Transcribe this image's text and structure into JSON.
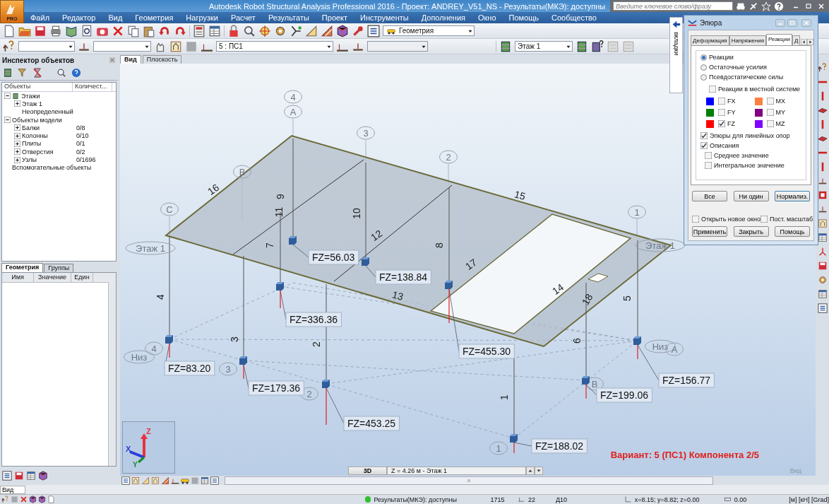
{
  "app": {
    "badge": "PRO"
  },
  "window": {
    "title": "Autodesk Robot Structural Analysis Professional 2016 - Проект: ANDREY_V51_NS - Результаты(МКЭ): доступны"
  },
  "search": {
    "placeholder": "Введите ключевое слово/фразу"
  },
  "menu": [
    "Файл",
    "Редактор",
    "Вид",
    "Геометрия",
    "Нагрузки",
    "Расчет",
    "Результаты",
    "Проект",
    "Инструменты",
    "Дополнения",
    "Окно",
    "Помощь",
    "Сообщество"
  ],
  "toolbar": {
    "view_combo": "Геометрия",
    "case_combo": "5 : ПС1",
    "floor_combo": "Этаж 1"
  },
  "inspector": {
    "title": "Инспектор объектов",
    "columns": [
      "Объекты",
      "Количест..."
    ],
    "tree": [
      {
        "label": "Этажи",
        "expanded": true,
        "children": [
          {
            "label": "Этаж 1",
            "expanded": false
          },
          {
            "label": "Неопределенный"
          }
        ]
      },
      {
        "label": "Объекты модели",
        "expanded": true,
        "children": [
          {
            "label": "Балки",
            "count": "0/8",
            "expanded": false
          },
          {
            "label": "Колонны",
            "count": "0/10",
            "expanded": false
          },
          {
            "label": "Плиты",
            "count": "0/1",
            "expanded": false
          },
          {
            "label": "Отверстия",
            "count": "0/2",
            "expanded": false
          },
          {
            "label": "Узлы",
            "count": "0/1696",
            "expanded": false
          }
        ]
      },
      {
        "label": "Вспомогательные объекты"
      }
    ],
    "tabs": [
      {
        "label": "Геометрия",
        "selected": true
      },
      {
        "label": "Группы",
        "selected": false
      }
    ],
    "props_columns": [
      "Имя",
      "Значение",
      "Един"
    ]
  },
  "view_tabs": [
    {
      "label": "Вид",
      "selected": true
    },
    {
      "label": "Плоскость",
      "selected": false
    }
  ],
  "viewport": {
    "member_labels": [
      "16",
      "11",
      "9",
      "10",
      "12",
      "7",
      "8",
      "17",
      "15",
      "13",
      "14",
      "18",
      "4",
      "3",
      "2",
      "1",
      "6",
      "5"
    ],
    "axis_labels": [
      "4",
      "A",
      "3",
      "2",
      "B",
      "C",
      "Этаж 1",
      "1",
      "Этаж 1",
      "Низ",
      "4",
      "3",
      "2",
      "1",
      "B",
      "Низ",
      "A"
    ],
    "reactions": [
      "FZ=56.03",
      "FZ=138.84",
      "FZ=336.36",
      "FZ=455.30",
      "FZ=83.20",
      "FZ=179.36",
      "FZ=453.25",
      "FZ=188.02",
      "FZ=199.06",
      "FZ=156.77"
    ],
    "triad": [
      "Z",
      "X",
      "Y"
    ],
    "caption": "Вариант: 5 (ПС1) Компонента 2/5",
    "mode_button": "3D",
    "level_field": "Z = 4.26 м - Этаж 1",
    "view_label": "Вид"
  },
  "dialog": {
    "title": "Эпюра",
    "side_tab": "вкладки",
    "tabs": [
      {
        "label": "Деформация",
        "selected": false
      },
      {
        "label": "Напряжения",
        "selected": false
      },
      {
        "label": "Реакции",
        "selected": true
      },
      {
        "label": "Д",
        "selected": false
      }
    ],
    "radios": [
      {
        "label": "Реакции",
        "selected": true
      },
      {
        "label": "Остаточные усилия",
        "selected": false
      },
      {
        "label": "Псевдостатические силы",
        "selected": false
      }
    ],
    "local_system": {
      "label": "Реакции в местной системе",
      "checked": false
    },
    "components": [
      {
        "label": "FX",
        "color": "#0000ff",
        "checked": false
      },
      {
        "label": "MX",
        "color": "#ff8040",
        "checked": false
      },
      {
        "label": "FY",
        "color": "#008000",
        "checked": false
      },
      {
        "label": "MY",
        "color": "#800080",
        "checked": false
      },
      {
        "label": "FZ",
        "color": "#ff0000",
        "checked": true
      },
      {
        "label": "MZ",
        "color": "#8000ff",
        "checked": false
      }
    ],
    "options": [
      {
        "label": "Эпюры для линейных опор",
        "checked": true
      },
      {
        "label": "Описания",
        "checked": true,
        "children": [
          {
            "label": "Среднее значение",
            "checked": false
          },
          {
            "label": "Интегральное значение",
            "checked": false
          }
        ]
      }
    ],
    "select_buttons": [
      "Все",
      "Ни один",
      "Нормализ."
    ],
    "bottom_checks": [
      {
        "label": "Открыть новое окно",
        "checked": false
      },
      {
        "label": "Пост. масштаб",
        "checked": false
      }
    ],
    "buttons": [
      "Применить",
      "Закрыть",
      "Помощь"
    ]
  },
  "view_field": {
    "value": "Вид"
  },
  "status_bar": {
    "message": "Результаты(МКЭ): доступны",
    "nodes": "1715",
    "bars": "22",
    "section": "Д10",
    "coords": "x=8.15; y=8.82; z=0.00",
    "angle": "0.00",
    "units": "[м] [кН] [Grad]"
  }
}
